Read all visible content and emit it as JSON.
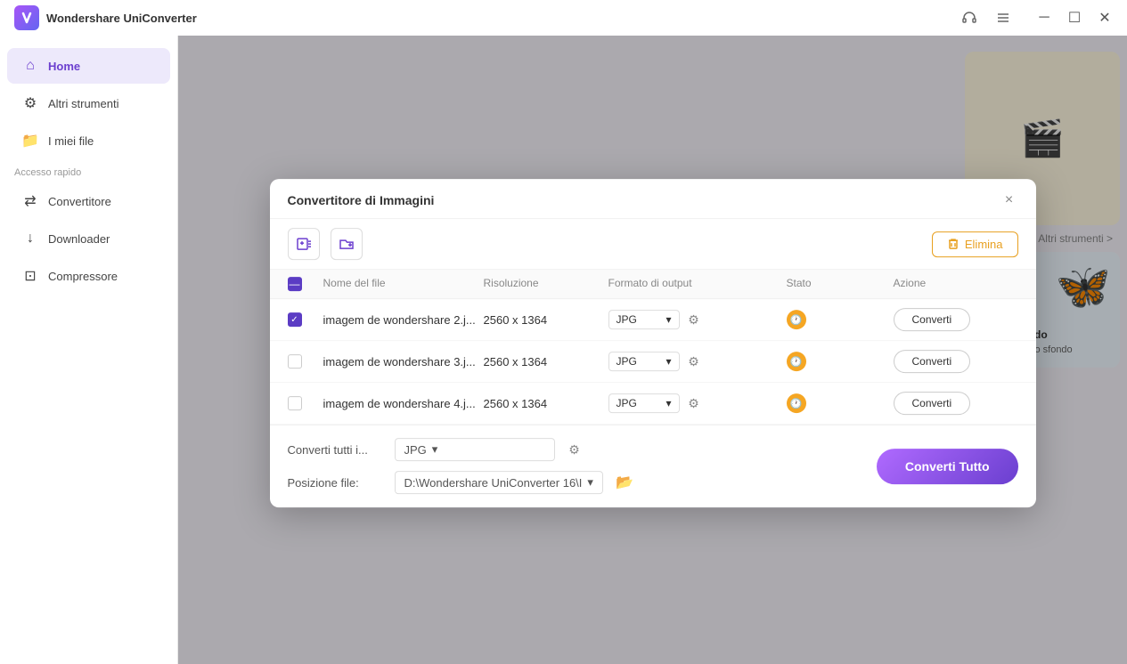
{
  "app": {
    "logo_letter": "W",
    "title": "Wondershare UniConverter"
  },
  "titlebar": {
    "controls": [
      "headset",
      "list",
      "minimize",
      "maximize",
      "close"
    ]
  },
  "sidebar": {
    "home_label": "Home",
    "other_tools_label": "Altri strumenti",
    "my_files_label": "I miei file",
    "quick_access_label": "Accesso rapido",
    "converter_label": "Convertitore",
    "downloader_label": "Downloader",
    "compressor_label": "Compressore"
  },
  "dialog": {
    "title": "Convertitore di Immagini",
    "delete_label": "Elimina",
    "close_label": "×",
    "table": {
      "headers": {
        "checkbox": "",
        "file_name": "Nome del file",
        "resolution": "Risoluzione",
        "output_format": "Formato di output",
        "status": "Stato",
        "action": "Azione"
      },
      "rows": [
        {
          "id": 1,
          "checked": true,
          "file_name": "imagem de wondershare 2.j...",
          "resolution": "2560 x 1364",
          "format": "JPG",
          "action_label": "Converti"
        },
        {
          "id": 2,
          "checked": false,
          "file_name": "imagem de wondershare 3.j...",
          "resolution": "2560 x 1364",
          "format": "JPG",
          "action_label": "Converti"
        },
        {
          "id": 3,
          "checked": false,
          "file_name": "imagem de wondershare 4.j...",
          "resolution": "2560 x 1364",
          "format": "JPG",
          "action_label": "Converti"
        }
      ]
    },
    "footer": {
      "convert_all_input_label": "Converti tutti i...",
      "convert_all_format": "JPG",
      "file_position_label": "Posizione file:",
      "file_position_value": "D:\\Wondershare UniConverter 16\\I",
      "convert_all_btn": "Converti Tutto"
    }
  },
  "background": {
    "other_tools_label": "Altri strumenti >",
    "bg_text": "e dello Sfondo",
    "bg_sub": "maticamente lo sfondo"
  }
}
